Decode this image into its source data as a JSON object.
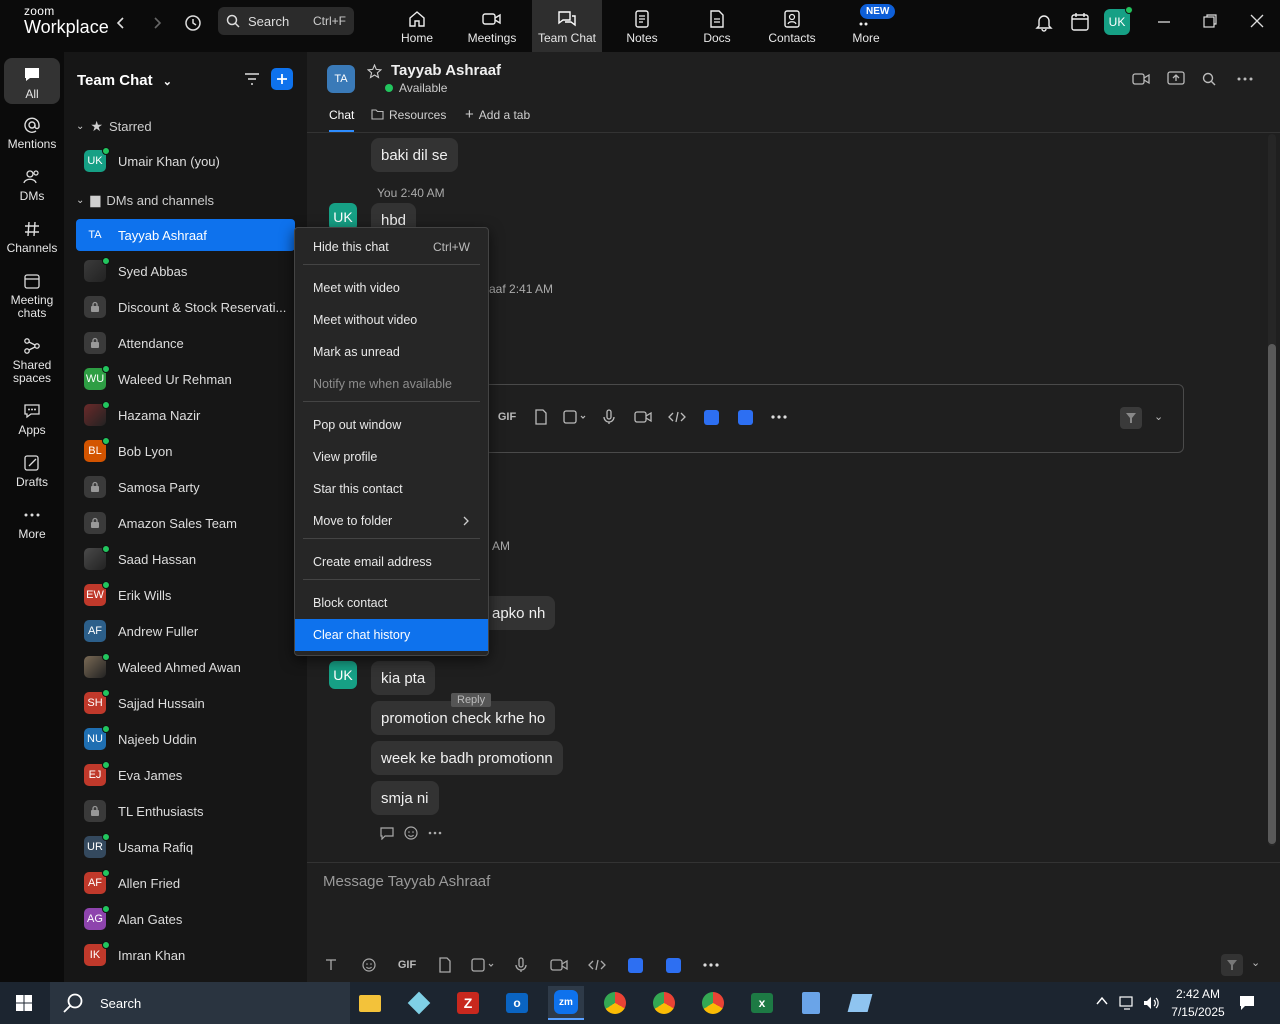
{
  "app": {
    "logo_line1": "zoom",
    "logo_line2": "Workplace"
  },
  "topbar": {
    "search_label": "Search",
    "search_shortcut": "Ctrl+F",
    "tabs": [
      {
        "label": "Home",
        "icon": "home-icon"
      },
      {
        "label": "Meetings",
        "icon": "video-icon"
      },
      {
        "label": "Team Chat",
        "icon": "chat-icon",
        "active": true
      },
      {
        "label": "Notes",
        "icon": "notes-icon"
      },
      {
        "label": "Docs",
        "icon": "docs-icon"
      },
      {
        "label": "Contacts",
        "icon": "contacts-icon"
      },
      {
        "label": "More",
        "icon": "more-icon"
      }
    ],
    "new_badge": "NEW",
    "user_initials": "UK"
  },
  "rail": [
    {
      "label": "All",
      "icon": "chat-bubble-icon",
      "active": true
    },
    {
      "label": "Mentions",
      "icon": "at-icon"
    },
    {
      "label": "DMs",
      "icon": "people-icon"
    },
    {
      "label": "Channels",
      "icon": "hash-icon"
    },
    {
      "label": "Meeting chats",
      "icon": "calendar-icon"
    },
    {
      "label": "Shared spaces",
      "icon": "share-icon"
    },
    {
      "label": "Apps",
      "icon": "apps-icon"
    },
    {
      "label": "Drafts",
      "icon": "drafts-icon"
    },
    {
      "label": "More",
      "icon": "dots-icon"
    }
  ],
  "sidebar": {
    "title": "Team Chat",
    "starred_label": "Starred",
    "starred": [
      {
        "name": "Umair Khan (you)",
        "initials": "UK",
        "color": "#16a085",
        "online": true
      }
    ],
    "dms_label": "DMs and channels",
    "items": [
      {
        "name": "Tayyab Ashraaf",
        "initials": "TA",
        "color": "#0e72ed",
        "online": false,
        "selected": true
      },
      {
        "name": "Syed Abbas",
        "initials": "",
        "color": "#3b3b3b",
        "online": true,
        "type": "photo"
      },
      {
        "name": "Discount & Stock Reservati...",
        "initials": "",
        "color": "#3a3a3a",
        "type": "lock"
      },
      {
        "name": "Attendance",
        "initials": "",
        "color": "#3a3a3a",
        "type": "lock"
      },
      {
        "name": "Waleed Ur Rehman",
        "initials": "WU",
        "color": "#2e9e44",
        "online": true
      },
      {
        "name": "Hazama Nazir",
        "initials": "",
        "color": "#6b2a2a",
        "online": true,
        "type": "photo"
      },
      {
        "name": "Bob Lyon",
        "initials": "BL",
        "color": "#d35400",
        "online": true
      },
      {
        "name": "Samosa Party",
        "initials": "",
        "color": "#3a3a3a",
        "type": "lock"
      },
      {
        "name": "Amazon Sales Team",
        "initials": "",
        "color": "#3a3a3a",
        "type": "lock"
      },
      {
        "name": "Saad Hassan",
        "initials": "",
        "color": "#4a4a4a",
        "online": true,
        "type": "photo"
      },
      {
        "name": "Erik Wills",
        "initials": "EW",
        "color": "#c0392b",
        "online": true
      },
      {
        "name": "Andrew Fuller",
        "initials": "AF",
        "color": "#2c5f8a",
        "online": false
      },
      {
        "name": "Waleed Ahmed Awan",
        "initials": "",
        "color": "#7a6a55",
        "online": true,
        "type": "photo"
      },
      {
        "name": "Sajjad Hussain",
        "initials": "SH",
        "color": "#c0392b",
        "online": true
      },
      {
        "name": "Najeeb Uddin",
        "initials": "NU",
        "color": "#1f6fb2",
        "online": true
      },
      {
        "name": "Eva James",
        "initials": "EJ",
        "color": "#c0392b",
        "online": true
      },
      {
        "name": "TL Enthusiasts",
        "initials": "",
        "color": "#3a3a3a",
        "type": "lock"
      },
      {
        "name": "Usama Rafiq",
        "initials": "UR",
        "color": "#34495e",
        "online": true
      },
      {
        "name": "Allen Fried",
        "initials": "AF",
        "color": "#c0392b",
        "online": true
      },
      {
        "name": "Alan Gates",
        "initials": "AG",
        "color": "#8e44ad",
        "online": true
      },
      {
        "name": "Imran Khan",
        "initials": "IK",
        "color": "#c0392b",
        "online": true
      }
    ]
  },
  "chat": {
    "contact_initials": "TA",
    "contact_name": "Tayyab Ashraaf",
    "status": "Available",
    "tabs": [
      "Chat",
      "Resources",
      "Add a tab"
    ],
    "messages": {
      "m1": "baki dil se",
      "meta1": "You 2:40 AM",
      "m2": "hbd",
      "meta2_partial": "aaf 2:41 AM",
      "meta3_partial": "AM",
      "m3": "apko nh",
      "m4": "kia pta",
      "m5": "promotion check krhe ho",
      "m6": "week ke badh promotionn",
      "m7": "smja ni"
    },
    "reply_tooltip": "Reply",
    "my_initials": "UK",
    "composer_placeholder": "Message Tayyab Ashraaf",
    "gif_label": "GIF"
  },
  "context_menu": {
    "items": [
      {
        "label": "Hide this chat",
        "shortcut": "Ctrl+W"
      },
      {
        "label": "Meet with video"
      },
      {
        "label": "Meet without video"
      },
      {
        "label": "Mark as unread"
      },
      {
        "label": "Notify me when available",
        "disabled": true
      },
      {
        "label": "Pop out window"
      },
      {
        "label": "View profile"
      },
      {
        "label": "Star this contact"
      },
      {
        "label": "Move to folder",
        "submenu": true
      },
      {
        "label": "Create email address"
      },
      {
        "label": "Block contact"
      },
      {
        "label": "Clear chat history",
        "highlighted": true
      }
    ]
  },
  "taskbar": {
    "search_label": "Search",
    "time": "2:42 AM",
    "date": "7/15/2025"
  }
}
